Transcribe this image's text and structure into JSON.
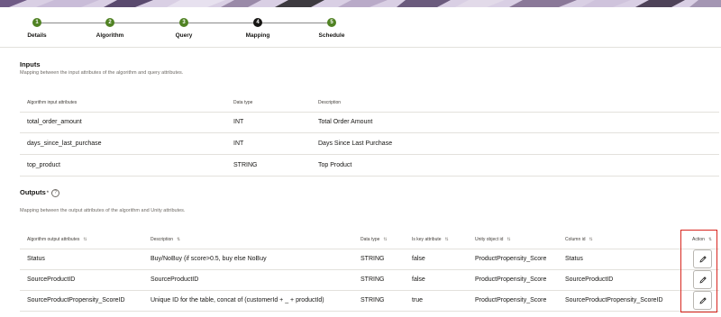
{
  "stepper": {
    "steps": [
      {
        "number": "1",
        "label": "Details",
        "state": "done"
      },
      {
        "number": "2",
        "label": "Algorithm",
        "state": "done"
      },
      {
        "number": "3",
        "label": "Query",
        "state": "done"
      },
      {
        "number": "4",
        "label": "Mapping",
        "state": "current"
      },
      {
        "number": "5",
        "label": "Schedule",
        "state": "done"
      }
    ]
  },
  "inputs": {
    "title": "Inputs",
    "description": "Mapping between the input attributes of the algorithm and query attributes.",
    "columns": [
      "Algorithm input attributes",
      "Data type",
      "Description"
    ],
    "rows": [
      [
        "total_order_amount",
        "INT",
        "Total Order Amount"
      ],
      [
        "days_since_last_purchase",
        "INT",
        "Days Since Last Purchase"
      ],
      [
        "top_product",
        "STRING",
        "Top Product"
      ]
    ]
  },
  "outputs": {
    "title": "Outputs",
    "required_mark": "*",
    "help_icon": "?",
    "description": "Mapping between the output attributes of the algorithm and Unity attributes.",
    "columns": [
      "Algorithm output attributes",
      "Description",
      "Data type",
      "Is key attribute",
      "Unity object id",
      "Column id",
      "Action"
    ],
    "sort_glyph": "⇅",
    "rows": [
      [
        "Status",
        "Buy/NoBuy (if score>0.5, buy else NoBuy",
        "STRING",
        "false",
        "ProductPropensity_Score",
        "Status"
      ],
      [
        "SourceProductID",
        "SourceProductID",
        "STRING",
        "false",
        "ProductPropensity_Score",
        "SourceProductID"
      ],
      [
        "SourceProductPropensity_ScoreID",
        "Unique ID for the table, concat of (customerId + _ + productId)",
        "STRING",
        "true",
        "ProductPropensity_Score",
        "SourceProductPropensity_ScoreID"
      ]
    ]
  },
  "colors": {
    "step_done": "#508223",
    "step_current": "#161513",
    "highlight": "#d8261f"
  }
}
